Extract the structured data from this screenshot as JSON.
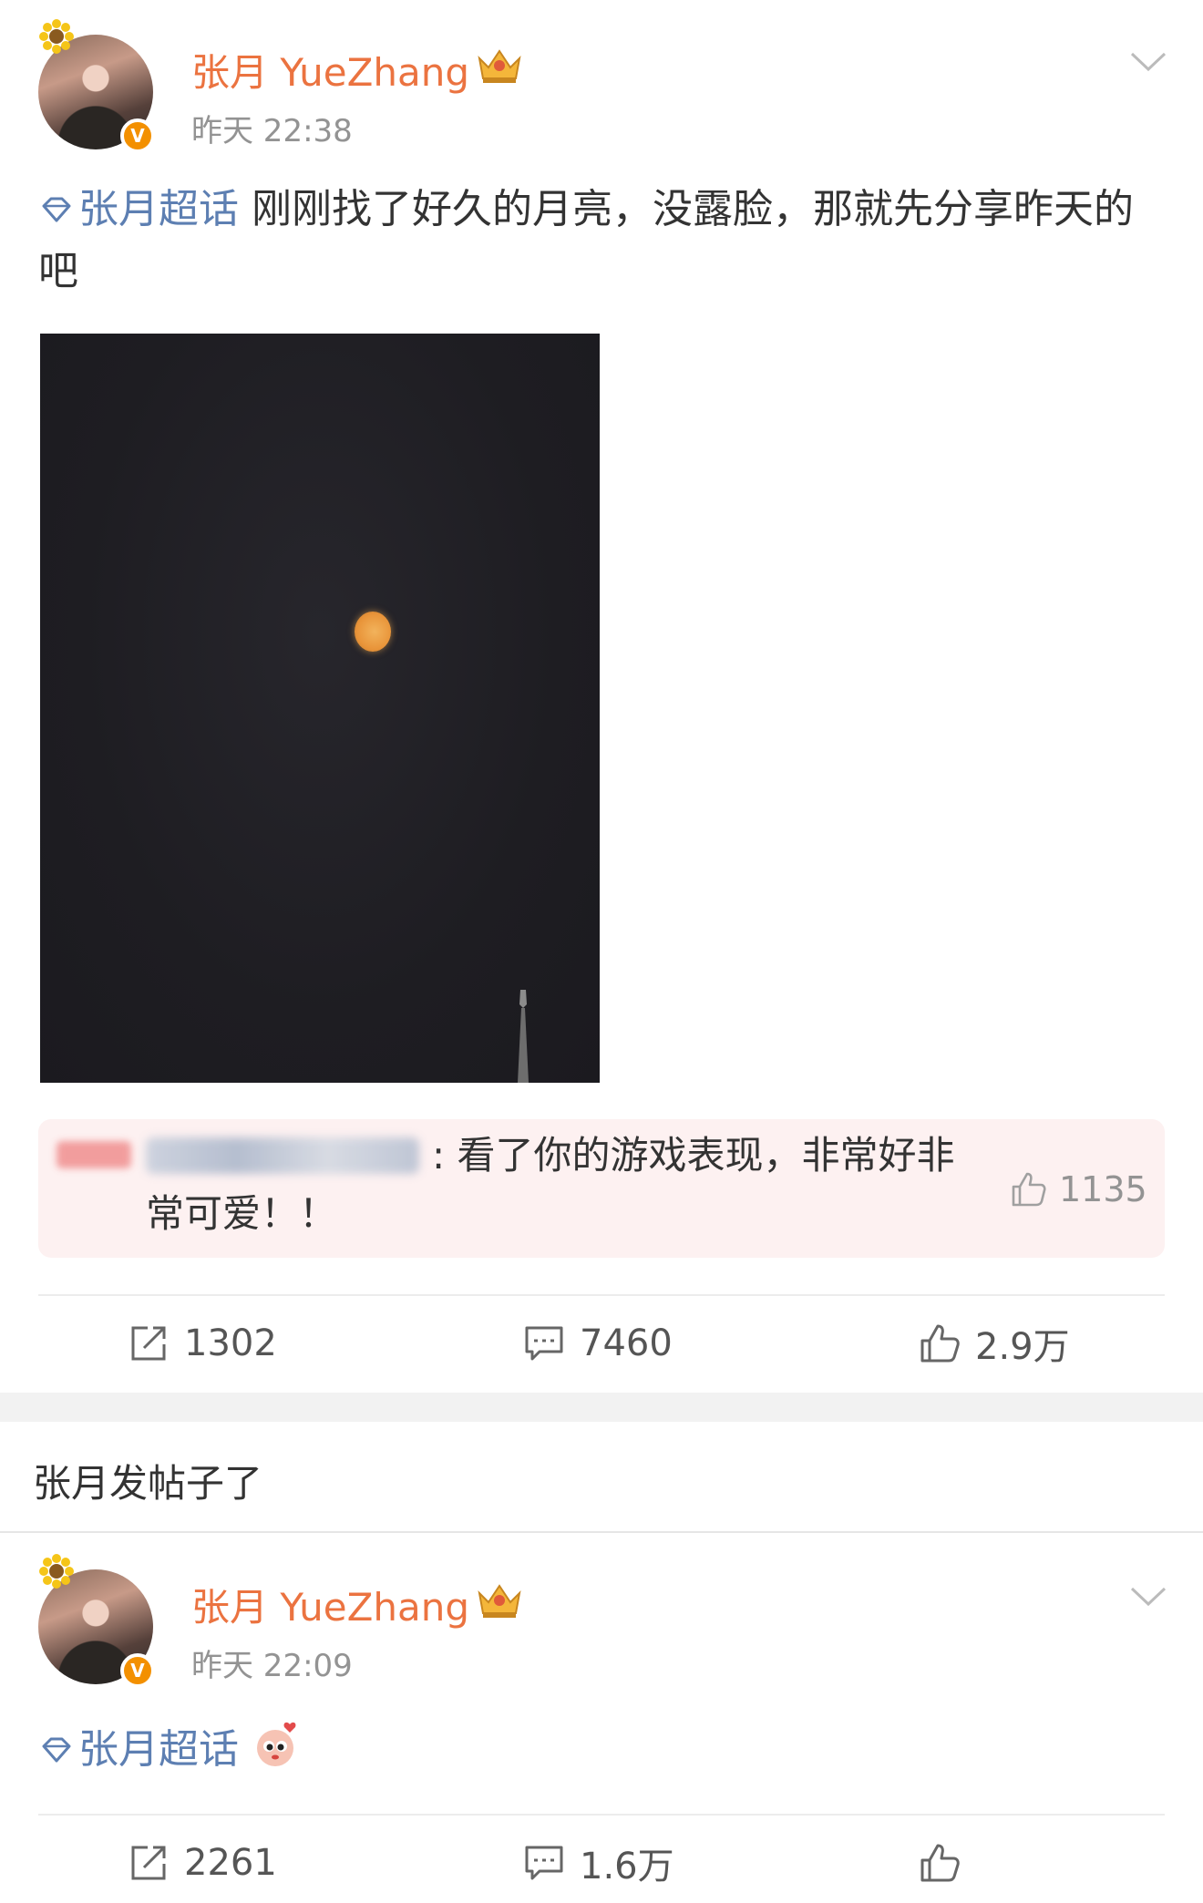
{
  "posts": [
    {
      "username": "张月 YueZhang",
      "timestamp": "昨天 22:38",
      "topic_link": "张月超话",
      "text": " 刚刚找了好久的月亮，没露脸，那就先分享昨天的吧",
      "icons": {
        "avatar_badge": "sunflower-icon",
        "verified": "verified-v-icon",
        "member": "crown-icon",
        "menu": "chevron-down-icon",
        "topic": "diamond-icon"
      },
      "image": "night-sky-moon-photo",
      "hot_comment": {
        "text": ": 看了你的游戏表现，非常好非常可爱！！",
        "likes": "1135"
      },
      "actions": {
        "reposts": "1302",
        "comments": "7460",
        "likes": "2.9万"
      }
    },
    {
      "username": "张月 YueZhang",
      "timestamp": "昨天 22:09",
      "topic_link": "张月超话",
      "actions": {
        "reposts": "2261",
        "comments": "1.6万",
        "likes": ""
      }
    }
  ],
  "section_title": "张月发帖子了",
  "colors": {
    "username": "#eb7340",
    "link": "#5d7fb2",
    "muted": "#939393",
    "comment_bg": "#fdf1f1",
    "verified": "#f39000"
  }
}
